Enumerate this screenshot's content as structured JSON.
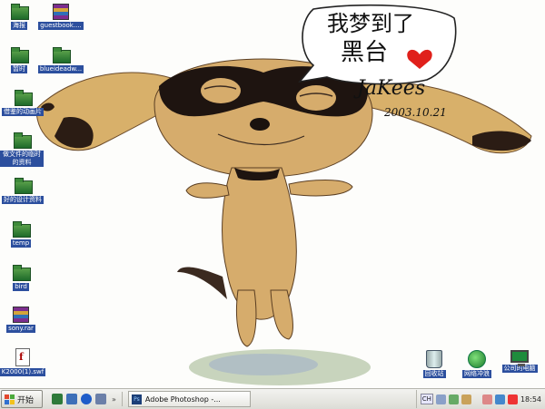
{
  "desktop": {
    "left_icons": [
      {
        "label": "海报",
        "type": "folder"
      },
      {
        "label": "暂时",
        "type": "folder"
      },
      {
        "label": "借鉴的动画片",
        "type": "folder"
      },
      {
        "label": "做文件的临时的资料",
        "type": "folder"
      },
      {
        "label": "好的设计资料",
        "type": "folder"
      },
      {
        "label": "temp",
        "type": "folder"
      },
      {
        "label": "bird",
        "type": "folder"
      },
      {
        "label": "sony.rar",
        "type": "rar"
      },
      {
        "label": "K2000(1).swf",
        "type": "swf"
      }
    ],
    "second_column_icons": [
      {
        "label": "guestbook....",
        "type": "rar"
      },
      {
        "label": "blueideadw...",
        "type": "folder"
      }
    ],
    "bottom_right_icons": [
      {
        "label": "回收站",
        "icon": "recycle-bin-icon"
      },
      {
        "label": "网络冲浪",
        "icon": "globe-icon"
      },
      {
        "label": "公司的电脑",
        "icon": "monitor-icon"
      }
    ]
  },
  "wallpaper": {
    "speech_text_line1": "我梦到了",
    "speech_text_line2": "黑台",
    "signature": "JaKees",
    "date": "2003.10.21",
    "heart_color": "#e0201b"
  },
  "taskbar": {
    "start_label": "开始",
    "task_label": "Adobe Photoshop -...",
    "lang": "CH",
    "clock": "18:54"
  }
}
